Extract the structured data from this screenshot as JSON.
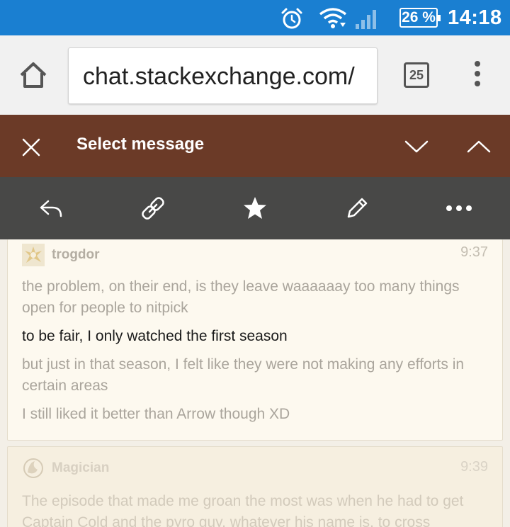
{
  "status_bar": {
    "battery": "26 %",
    "time": "14:18"
  },
  "browser": {
    "url": "chat.stackexchange.com/",
    "tab_count": "25"
  },
  "selection_header": {
    "title": "Select message"
  },
  "toolbar": {
    "actions": [
      "reply",
      "permalink",
      "star",
      "edit",
      "more"
    ]
  },
  "messages": [
    {
      "user": "trogdor",
      "time": "9:37",
      "lines": [
        "the problem, on their end, is they leave waaaaaay too many things open for people to nitpick",
        "to be fair, I only watched the first season",
        "but just in that season, I felt like they were not making any efforts in certain areas",
        "I still liked it better than Arrow though XD"
      ]
    },
    {
      "user": "Magician",
      "time": "9:39",
      "lines": [
        "The episode that made me groan the most was when he had to get Captain Cold and the pyro guy, whatever his name is, to cross"
      ]
    }
  ],
  "colors": {
    "status_bar": "#1a7fd1",
    "selection_header": "#6b3a27",
    "toolbar": "#3a3a3a",
    "card": "#fdf9ef"
  }
}
